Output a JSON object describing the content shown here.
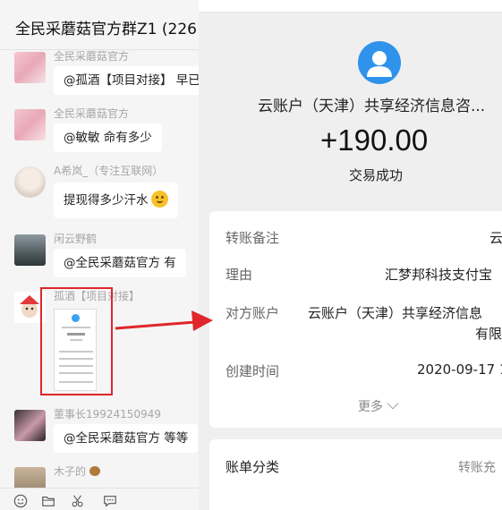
{
  "chat": {
    "title": "全民采蘑菇官方群Z1 (226",
    "messages": [
      {
        "sender": "全民采蘑菇官方",
        "text": "@孤酒【项目对接】 早已"
      },
      {
        "sender": "全民采蘑菇官方",
        "text": "@敏敏 命有多少"
      },
      {
        "sender": "A希岚_（专注互联网）",
        "text": "提现得多少汗水"
      },
      {
        "sender": "闲云野鹤",
        "text": "@全民采蘑菇官方 有"
      },
      {
        "sender": "孤酒【项目对接】",
        "text": ""
      },
      {
        "sender": "董事长19924150949",
        "text": "@全民采蘑菇官方 等等"
      },
      {
        "sender": "木子的",
        "text": ""
      }
    ],
    "toolbar_icons": [
      "emoji-icon",
      "folder-icon",
      "scissors-icon",
      "chat-bubble-icon"
    ]
  },
  "payment": {
    "payee": "云账户（天津）共享经济信息咨...",
    "amount": "+190.00",
    "status": "交易成功",
    "details": [
      {
        "label": "转账备注",
        "value": "云"
      },
      {
        "label": "理由",
        "value": "汇梦邦科技支付宝"
      },
      {
        "label": "对方账户",
        "value": "云账户（天津）共享经济信息",
        "value2": "有限"
      },
      {
        "label": "创建时间",
        "value": "2020-09-17 1"
      }
    ],
    "more_label": "更多",
    "bill_category_label": "账单分类",
    "bill_category_value": "转账充"
  },
  "colors": {
    "annotation_red": "#e0262a",
    "avatar_blue": "#2f93ec"
  }
}
